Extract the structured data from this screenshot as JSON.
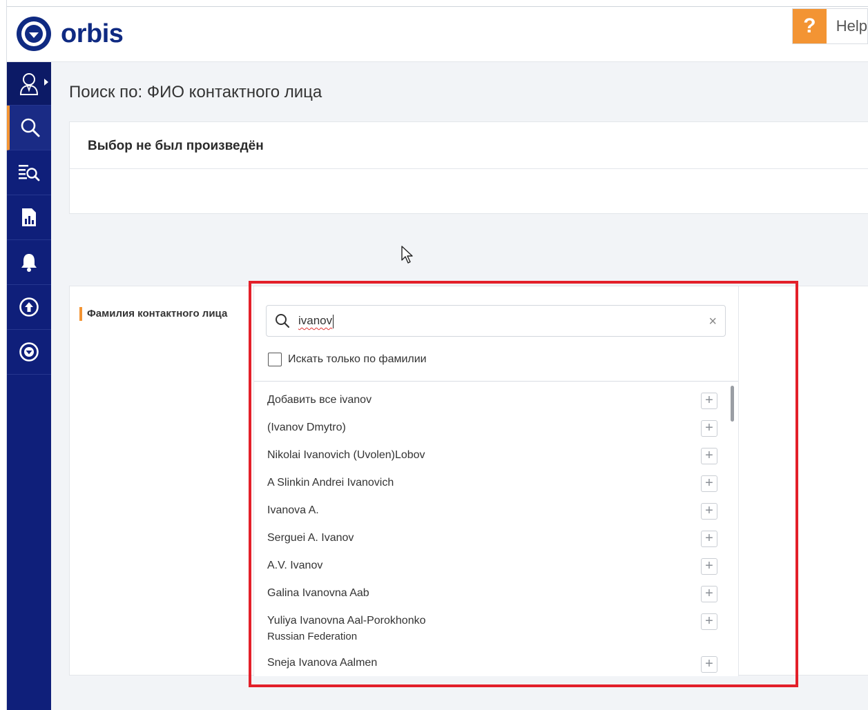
{
  "app": {
    "logo_text": "orbis",
    "help_icon": "?",
    "help_label": "Help"
  },
  "sidebar": {
    "items": [
      {
        "icon": "user-icon"
      },
      {
        "icon": "search-icon",
        "active": true
      },
      {
        "icon": "list-search-icon"
      },
      {
        "icon": "report-icon"
      },
      {
        "icon": "bell-icon"
      },
      {
        "icon": "upload-icon"
      },
      {
        "icon": "orbis-logo-icon"
      }
    ]
  },
  "page": {
    "title": "Поиск по: ФИО контактного лица",
    "selection_empty": "Выбор не был произведён"
  },
  "form": {
    "field_label": "Фамилия контактного лица",
    "search_value": "ivanov",
    "search_only_surname_label": "Искать только по фамилии",
    "search_only_surname_checked": false,
    "results": [
      {
        "name": "Добавить все ivanov"
      },
      {
        "name": "(Ivanov Dmytro)"
      },
      {
        "name": "Nikolai Ivanovich (Uvolen)Lobov"
      },
      {
        "name": "A Slinkin Andrei Ivanovich"
      },
      {
        "name": "Ivanova A."
      },
      {
        "name": "Serguei A. Ivanov"
      },
      {
        "name": "A.V. Ivanov"
      },
      {
        "name": "Galina Ivanovna Aab"
      },
      {
        "name": "Yuliya Ivanovna Aal-Porokhonko",
        "sub": "Russian Federation"
      },
      {
        "name": "Sneja Ivanova Aalmen"
      }
    ],
    "add_symbol": "+"
  },
  "colors": {
    "brand_navy": "#0f2a82",
    "sidebar_bg": "#0f1f7a",
    "accent_orange": "#f39433",
    "highlight_red": "#e3202a"
  }
}
